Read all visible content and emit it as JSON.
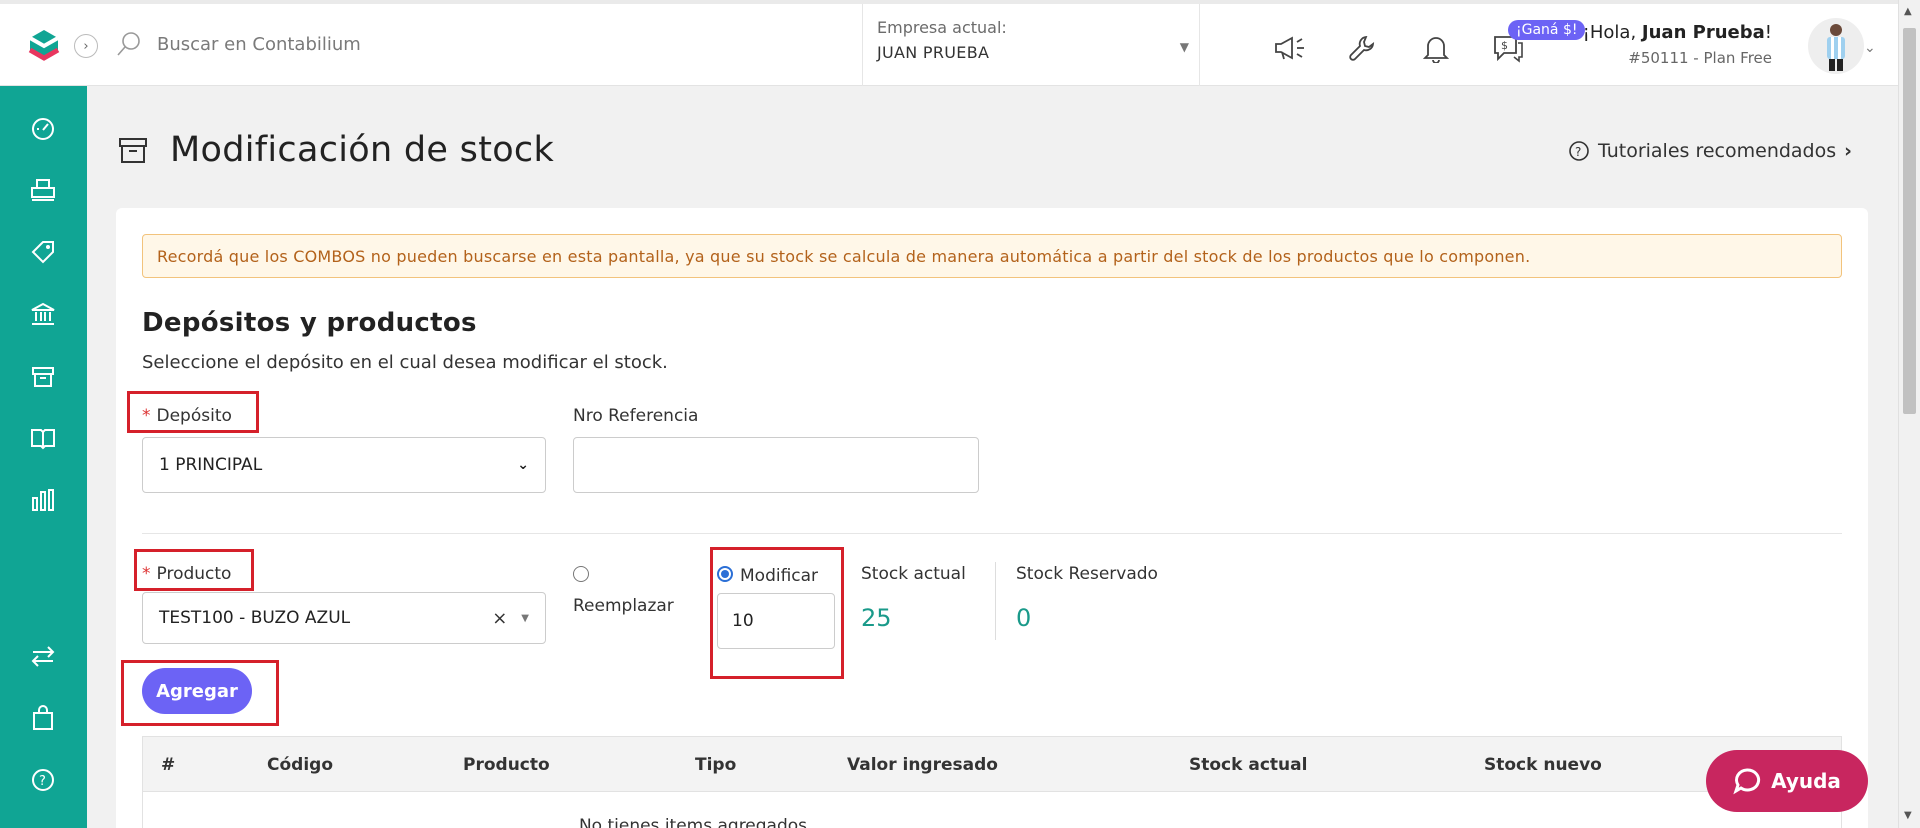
{
  "header": {
    "search_placeholder": "Buscar en Contabilium",
    "company_label": "Empresa actual:",
    "company_value": "JUAN PRUEBA",
    "badge": "¡Ganá $!",
    "greeting_prefix": "¡Hola, ",
    "user_name": "Juan Prueba",
    "greeting_suffix": "!",
    "plan": "#50111 - Plan Free"
  },
  "page": {
    "title": "Modificación de stock",
    "tutorials": "Tutoriales recomendados"
  },
  "alert": "Recordá que los COMBOS no pueden buscarse en esta pantalla, ya que su stock se calcula de manera automática a partir del stock de los productos que lo componen.",
  "section": {
    "title": "Depósitos y productos",
    "subtitle": "Seleccione el depósito en el cual desea modificar el stock."
  },
  "form": {
    "deposito_label": "Depósito",
    "deposito_value": "1 PRINCIPAL",
    "referencia_label": "Nro Referencia",
    "referencia_value": "",
    "producto_label": "Producto",
    "producto_value": "TEST100 - BUZO AZUL",
    "reemplazar_label": "Reemplazar",
    "modificar_label": "Modificar",
    "modificar_value": "10",
    "stock_actual_label": "Stock actual",
    "stock_actual_value": "25",
    "stock_reservado_label": "Stock Reservado",
    "stock_reservado_value": "0",
    "selected_mode": "Modificar",
    "add_button": "Agregar"
  },
  "table": {
    "columns": [
      "#",
      "Código",
      "Producto",
      "Tipo",
      "Valor ingresado",
      "Stock actual",
      "Stock nuevo"
    ],
    "empty_text": "No tienes items agregados"
  },
  "help_button": "Ayuda",
  "colors": {
    "sidebar": "#10a594",
    "accent": "#6c63f5",
    "help": "#c8265f",
    "highlight": "#d5202a"
  },
  "icons": {
    "sidebar": [
      "dashboard-icon",
      "printer-icon",
      "tag-icon",
      "bank-icon",
      "box-icon",
      "book-icon",
      "bar-chart-icon",
      "transfer-icon",
      "shopping-bag-icon",
      "help-circle-icon"
    ],
    "header": [
      "megaphone-icon",
      "wrench-icon",
      "bell-icon",
      "chat-money-icon"
    ]
  }
}
